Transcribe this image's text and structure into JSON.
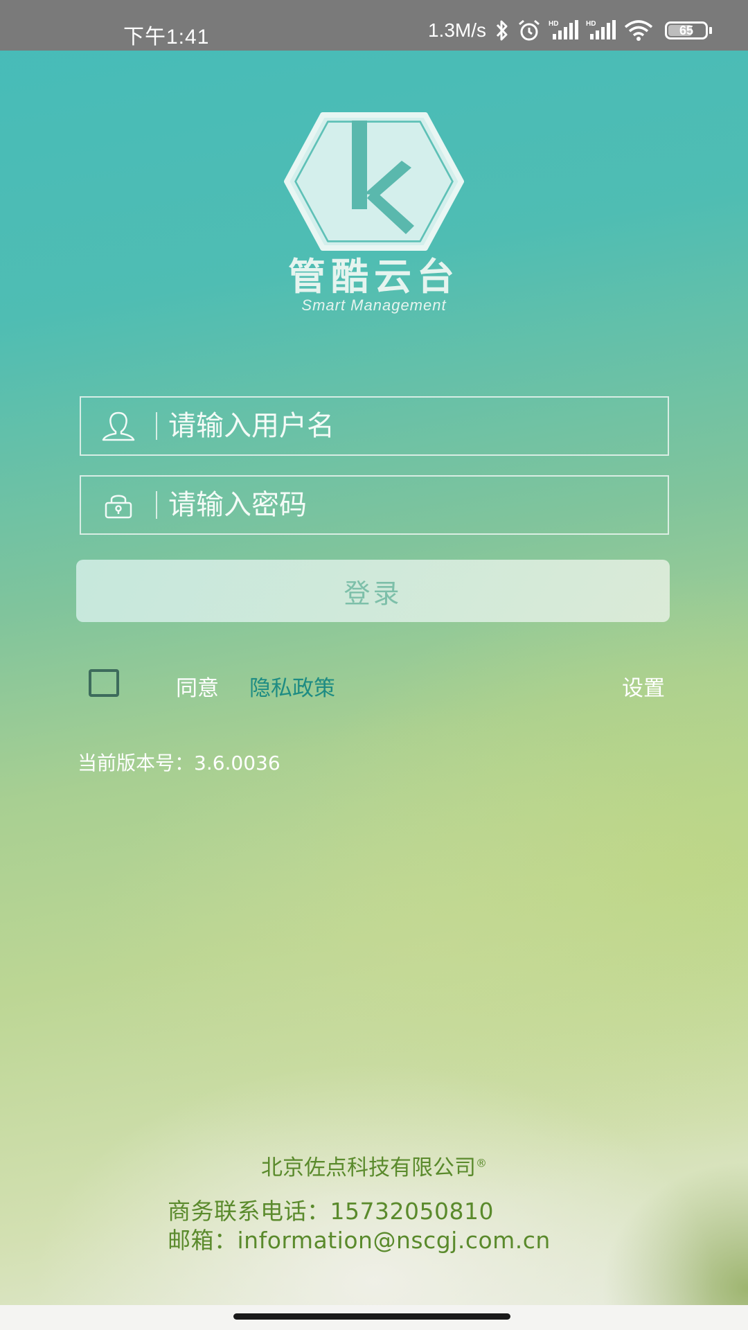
{
  "status_bar": {
    "time": "下午1:41",
    "net_speed": "1.3M/s",
    "battery_level": "65",
    "icons": [
      "bluetooth-icon",
      "alarm-icon",
      "signal-hd-icon",
      "signal-hd-icon",
      "wifi-icon",
      "battery-icon"
    ]
  },
  "logo": {
    "letter": "k",
    "title": "管酷云台",
    "subtitle": "Smart Management"
  },
  "login_form": {
    "username_placeholder": "请输入用户名",
    "username_value": "",
    "password_placeholder": "请输入密码",
    "password_value": "",
    "username_icon": "user-icon",
    "password_icon": "lock-icon",
    "login_label": "登录"
  },
  "agreement": {
    "checked": false,
    "agree_label": "同意",
    "policy_label": "隐私政策",
    "settings_label": "设置"
  },
  "version_text": "当前版本号：3.6.0036",
  "footer": {
    "company": "北京佐点科技有限公司",
    "registered_mark": "®",
    "phone_line": "商务联系电话：15732050810",
    "email_line": "邮箱：information@nscgj.com.cn"
  },
  "colors": {
    "accent_teal": "#46bbb9",
    "policy_link": "#1e8c83",
    "footer_text": "#5a8a2c",
    "login_button_text": "#7dbfa9"
  }
}
